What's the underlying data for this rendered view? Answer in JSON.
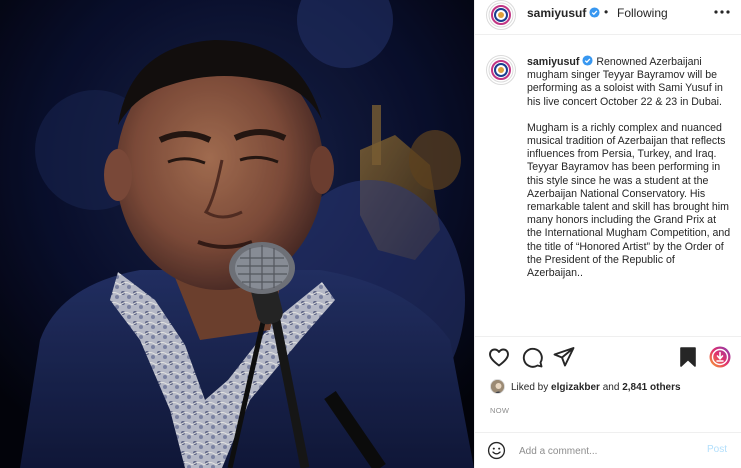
{
  "post": {
    "username": "samiyusuf",
    "dot": "•",
    "follow_label": "Following",
    "more_icon": "more-horizontal-icon",
    "caption_username": "samiyusuf",
    "caption_p1": "Renowned Azerbaijani mugham singer Teyyar Bayramov will be performing as a soloist with Sami Yusuf in his live concert October 22 & 23 in Dubai.",
    "caption_p2": "Mugham is a richly complex and nuanced musical tradition of Azerbaijan that reflects influences from Persia, Turkey, and Iraq. Teyyar Bayramov has been performing in this style since he was a student at the Azerbaijan National Conservatory. His remarkable talent and skill has brought him many honors including the Grand Prix at the International Mugham Competition, and the title of “Honored Artist” by the Order of the President of the Republic of Azerbaijan..",
    "liked_prefix": "Liked by ",
    "liked_user": "elgizakber",
    "liked_and": " and ",
    "liked_others": "2,841 others",
    "timestamp": "NOW",
    "comment_placeholder": "Add a comment...",
    "post_label": "Post"
  },
  "colors": {
    "verified": "#3897f0",
    "link_disabled": "#b2dffc",
    "muted": "#8e8e8e",
    "text": "#262626",
    "badge": "#c13584"
  },
  "icons": [
    "heart-icon",
    "comment-icon",
    "share-icon",
    "bookmark-icon",
    "reels-badge-icon",
    "emoji-icon",
    "verified-icon"
  ]
}
